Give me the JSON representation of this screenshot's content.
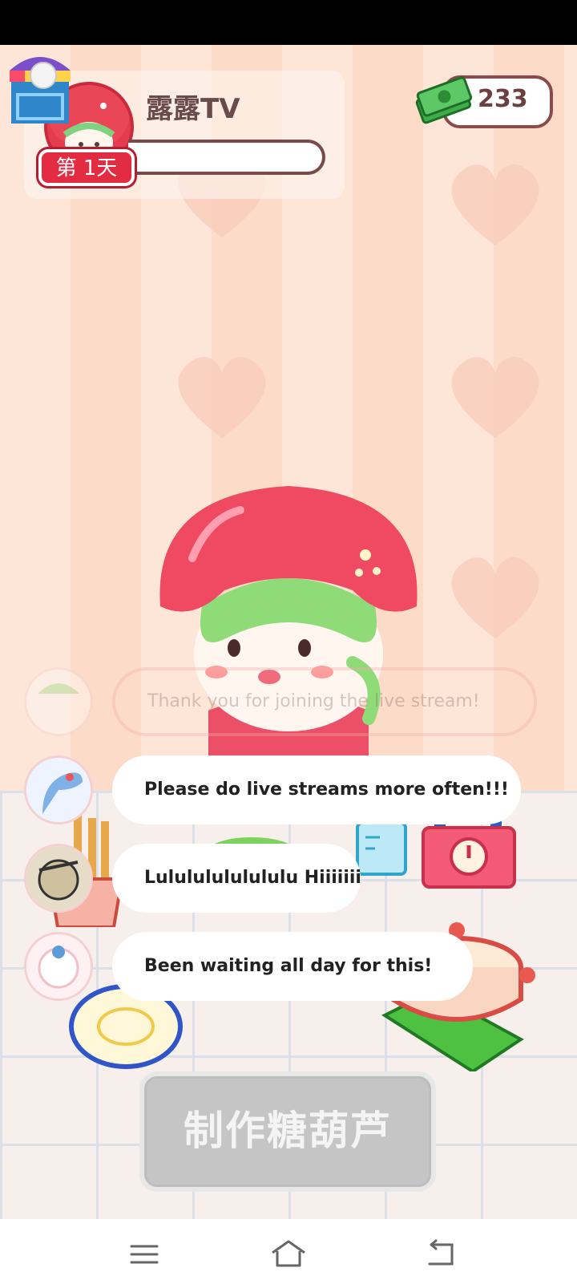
{
  "header": {
    "channel_name": "露露TV",
    "day_badge": "第 1天",
    "coins": "233"
  },
  "chat": [
    {
      "message": "Thank you for joining the live stream!",
      "faded": true
    },
    {
      "message": "Please do live streams more often!!!"
    },
    {
      "message": "Lulululululululu Hiiiiiii"
    },
    {
      "message": "Been waiting all day for this!"
    }
  ],
  "actions": {
    "make_button": "制作糖葫芦"
  },
  "colors": {
    "accent_red": "#e32b42",
    "button_disabled": "#c5c5c5",
    "background": "#fde6d8"
  },
  "icons": [
    "shop-icon",
    "money-icon",
    "menu-icon",
    "home-icon",
    "back-icon"
  ]
}
